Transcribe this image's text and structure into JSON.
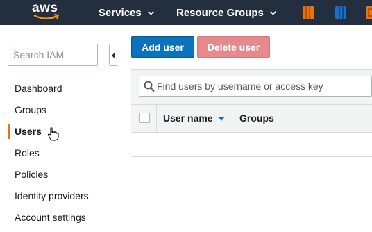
{
  "topnav": {
    "logo_text": "aws",
    "services_label": "Services",
    "resource_groups_label": "Resource Groups",
    "service_icons": [
      "ec2-icon",
      "s3-icon",
      "service-icon"
    ],
    "colors": {
      "bar": "#232f3e",
      "accent": "#ec7211",
      "blue": "#1b6fc5"
    }
  },
  "sidebar": {
    "search_placeholder": "Search IAM",
    "items": [
      {
        "label": "Dashboard"
      },
      {
        "label": "Groups"
      },
      {
        "label": "Users",
        "active": true
      },
      {
        "label": "Roles"
      },
      {
        "label": "Policies"
      },
      {
        "label": "Identity providers"
      },
      {
        "label": "Account settings"
      }
    ]
  },
  "main": {
    "add_user_label": "Add user",
    "delete_user_label": "Delete user",
    "find_placeholder": "Find users by username or access key",
    "columns": [
      "User name",
      "Groups"
    ],
    "sorted_column": "User name",
    "sort_direction": "descending"
  }
}
